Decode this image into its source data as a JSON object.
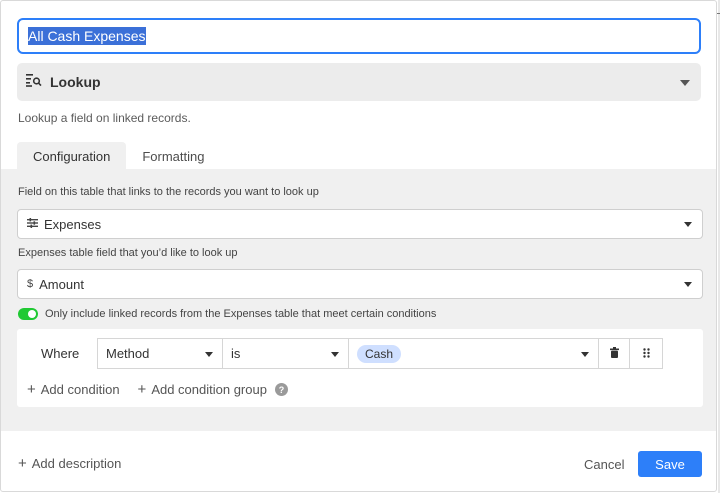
{
  "field_name": {
    "value": "All Cash Expenses"
  },
  "field_type": {
    "label": "Lookup",
    "icon": "lookup-icon",
    "description": "Lookup a field on linked records."
  },
  "tabs": [
    {
      "label": "Configuration",
      "active": true
    },
    {
      "label": "Formatting",
      "active": false
    }
  ],
  "config": {
    "link_field_label": "Field on this table that links to the records you want to look up",
    "link_field_value": "Expenses",
    "link_field_icon": "linked-records-icon",
    "lookup_field_label": "Expenses table field that you’d like to look up",
    "lookup_field_value": "Amount",
    "lookup_field_icon": "currency-icon",
    "conditions_toggle": {
      "on": true,
      "label": "Only include linked records from the Expenses table that meet certain conditions"
    },
    "condition": {
      "prefix": "Where",
      "field": "Method",
      "operator": "is",
      "value": "Cash"
    },
    "add_condition": "Add condition",
    "add_condition_group": "Add condition group"
  },
  "footer": {
    "add_description": "Add description",
    "cancel": "Cancel",
    "save": "Save"
  },
  "colors": {
    "accent": "#2d7ff9",
    "toggle_on": "#20c933",
    "pill": "#cfdfff"
  }
}
